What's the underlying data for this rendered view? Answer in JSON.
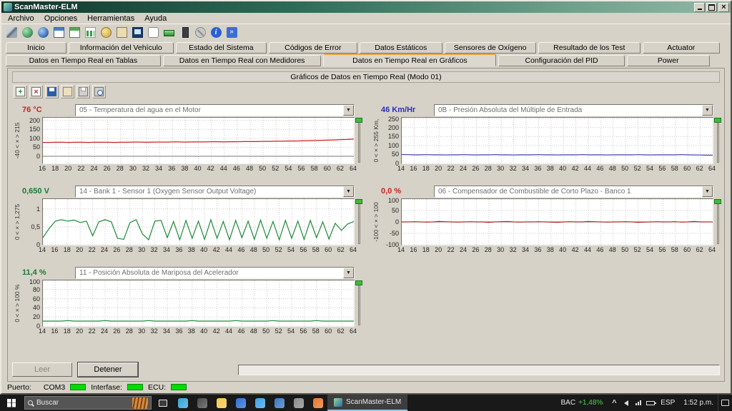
{
  "window": {
    "title": "ScanMaster-ELM",
    "menus": [
      "Archivo",
      "Opciones",
      "Herramientas",
      "Ayuda"
    ]
  },
  "toolbar": {
    "icons": [
      "tools-icon",
      "globe-icon",
      "connect-icon",
      "table-icon",
      "gauges-icon",
      "graph-icon",
      "money-icon",
      "clipboard-icon",
      "terminal-icon",
      "chat-icon",
      "battery-icon",
      "device-icon",
      "stop-icon",
      "info-icon",
      "exit-icon"
    ]
  },
  "tabs": {
    "row1": [
      "Inicio",
      "Información del Vehículo",
      "Estado del Sistema",
      "Códigos de Error",
      "Datos Estáticos",
      "Sensores de Oxígeno",
      "Resultado de los Test",
      "Actuator"
    ],
    "row2": [
      "Datos en Tiempo Real en Tablas",
      "Datos en Tiempo Real con Medidores",
      "Datos en Tiempo Real en Gráficos",
      "Configuración del PID",
      "Power"
    ],
    "active_row2_index": 2,
    "active_accent": "#e8a33d"
  },
  "panel": {
    "title": "Gráficos de Datos en Tiempo Real (Modo 01)",
    "tool_icons": [
      "chart-add-icon",
      "chart-del-icon",
      "save-icon",
      "export-icon",
      "print-icon",
      "preview-icon"
    ]
  },
  "axis_separator": "< × >",
  "chart_data": [
    {
      "type": "line",
      "title": "05 - Temperatura del agua en el Motor",
      "value": "76 °C",
      "value_color": "#cc2020",
      "color": "#cc2020",
      "range_min": "-40",
      "range_max": "215",
      "ymin": -40,
      "ymax": 215,
      "yticks": [
        0,
        50,
        100,
        150,
        200
      ],
      "ytick_labels": [
        "0",
        "50",
        "100",
        "150",
        "200"
      ],
      "xmin": 16,
      "xmax": 64,
      "xstep": 2,
      "values": [
        77,
        77,
        78,
        78,
        77,
        78,
        78,
        77,
        78,
        78,
        78,
        77,
        78,
        78,
        79,
        79,
        78,
        79,
        79,
        79,
        80,
        80,
        79,
        80,
        80,
        80,
        81,
        81,
        80,
        81,
        81,
        82,
        82,
        82,
        83,
        83,
        84,
        84,
        85,
        85,
        86,
        87,
        88,
        89,
        90,
        91,
        93,
        94,
        96
      ]
    },
    {
      "type": "line",
      "title": "0B - Presión Absoluta del Múltiple de Entrada",
      "value": "46 Km/Hr",
      "value_color": "#2a2ec0",
      "color": "#4444b8",
      "range_min": "0",
      "range_max": "255 Km,",
      "ymin": 0,
      "ymax": 255,
      "yticks": [
        0,
        50,
        100,
        150,
        200,
        250
      ],
      "ytick_labels": [
        "0",
        "50",
        "100",
        "150",
        "200",
        "250"
      ],
      "xmin": 14,
      "xmax": 64,
      "xstep": 2,
      "values": [
        50,
        49,
        48,
        48,
        49,
        48,
        48,
        47,
        48,
        48,
        49,
        48,
        47,
        48,
        48,
        49,
        48,
        48,
        47,
        48,
        48,
        48,
        49,
        48,
        48,
        47,
        48,
        48,
        48,
        49,
        48,
        48,
        48,
        47,
        48,
        48,
        48,
        48,
        49,
        48,
        47,
        48,
        48,
        48,
        48,
        49,
        48,
        47,
        47,
        46,
        46
      ]
    },
    {
      "type": "line",
      "title": "14 - Bank 1 - Sensor 1 (Oxygen Sensor Output Voltage)",
      "value": "0,650 V",
      "value_color": "#1a7a34",
      "color": "#1f8a3a",
      "range_min": "0",
      "range_max": "1,275",
      "ymin": 0,
      "ymax": 1.275,
      "yticks": [
        0,
        0.5,
        1
      ],
      "ytick_labels": [
        "0",
        "0,5",
        "1"
      ],
      "xmin": 14,
      "xmax": 64,
      "xstep": 2,
      "values": [
        0.2,
        0.45,
        0.66,
        0.7,
        0.66,
        0.69,
        0.62,
        0.66,
        0.25,
        0.64,
        0.7,
        0.64,
        0.18,
        0.15,
        0.62,
        0.7,
        0.3,
        0.14,
        0.66,
        0.68,
        0.2,
        0.65,
        0.14,
        0.68,
        0.18,
        0.66,
        0.15,
        0.7,
        0.18,
        0.65,
        0.14,
        0.68,
        0.2,
        0.66,
        0.15,
        0.69,
        0.18,
        0.65,
        0.14,
        0.68,
        0.18,
        0.66,
        0.15,
        0.68,
        0.2,
        0.64,
        0.16,
        0.6,
        0.4,
        0.58,
        0.65
      ]
    },
    {
      "type": "line",
      "title": "06 - Compensador de Combustible de Corto Plazo - Banco 1",
      "value": "0,0 %",
      "value_color": "#cc2020",
      "color": "#b02828",
      "range_min": "-100",
      "range_max": "100",
      "ymin": -100,
      "ymax": 100,
      "yticks": [
        -100,
        -50,
        0,
        50,
        100
      ],
      "ytick_labels": [
        "-100",
        "-50",
        "0",
        "50",
        "100"
      ],
      "xmin": 14,
      "xmax": 64,
      "xstep": 2,
      "values": [
        0,
        0,
        1,
        0,
        -1,
        0,
        2,
        1,
        0,
        -1,
        0,
        1,
        0,
        0,
        -2,
        0,
        1,
        2,
        0,
        -1,
        0,
        0,
        1,
        0,
        -1,
        -2,
        0,
        1,
        0,
        0,
        2,
        1,
        0,
        -1,
        0,
        0,
        1,
        0,
        -2,
        -1,
        0,
        1,
        0,
        0,
        1,
        -1,
        0,
        2,
        0,
        0,
        0
      ]
    },
    {
      "type": "line",
      "title": "11 - Posición Absoluta de Mariposa del Acelerador",
      "value": "11,4 %",
      "value_color": "#1a7a34",
      "color": "#1f8a3a",
      "range_min": "0",
      "range_max": "100 %",
      "ymin": 0,
      "ymax": 100,
      "yticks": [
        0,
        20,
        40,
        60,
        80,
        100
      ],
      "ytick_labels": [
        "0",
        "20",
        "40",
        "60",
        "80",
        "100"
      ],
      "xmin": 14,
      "xmax": 64,
      "xstep": 2,
      "values": [
        11,
        11,
        11,
        11,
        12,
        11,
        11,
        11,
        11,
        11,
        12,
        11,
        11,
        11,
        11,
        11,
        11,
        12,
        11,
        11,
        11,
        11,
        11,
        11,
        12,
        11,
        11,
        11,
        11,
        11,
        11,
        12,
        11,
        11,
        11,
        11,
        11,
        12,
        11,
        11,
        11,
        11,
        11,
        11,
        12,
        11,
        11,
        11,
        11,
        11,
        11
      ]
    }
  ],
  "footer": {
    "read_label": "Leer",
    "stop_label": "Detener"
  },
  "statusbar": {
    "port_label": "Puerto:",
    "port_value": "COM3",
    "interface_label": "Interfase:",
    "ecu_label": "ECU:",
    "ok_color": "#00dc00"
  },
  "taskbar": {
    "search_text": "Buscar",
    "app_label": "ScanMaster-ELM",
    "apps": [
      {
        "name": "edge-icon",
        "color": "#35a5d8"
      },
      {
        "name": "widgets-icon",
        "color": "#4a4a4a"
      },
      {
        "name": "explorer-icon",
        "color": "#f5c84c"
      },
      {
        "name": "store-icon",
        "color": "#2a6fd4"
      },
      {
        "name": "mail-icon",
        "color": "#3aa0e8"
      },
      {
        "name": "photos-icon",
        "color": "#3a77c2"
      },
      {
        "name": "settings-icon",
        "color": "#8a8a8a"
      },
      {
        "name": "media-icon",
        "color": "#e8762a"
      }
    ],
    "tray": {
      "ticker": "BAC",
      "ticker_change": "+1,48%",
      "language": "ESP",
      "time": "1:52 p.m."
    }
  }
}
